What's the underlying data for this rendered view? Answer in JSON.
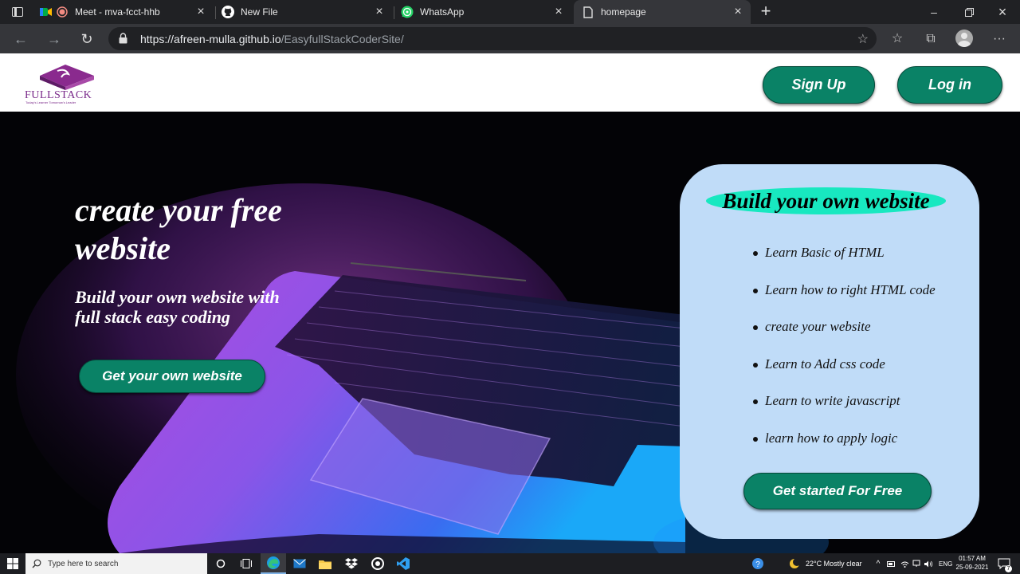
{
  "browser": {
    "tabs": [
      {
        "label": "Meet - mva-fcct-hhb"
      },
      {
        "label": "New File"
      },
      {
        "label": "WhatsApp"
      },
      {
        "label": "homepage"
      }
    ],
    "url_host": "https://afreen-mulla.github.io",
    "url_path": "/EasyfullStackCoderSite/"
  },
  "site": {
    "logo_text": "FULLSTACK",
    "logo_tagline": "Today's Learner Tomorrow's Leader",
    "signup_label": "Sign Up",
    "login_label": "Log in",
    "hero": {
      "title": "create your free website",
      "subtitle": "Build your own website with full stack easy coding",
      "cta_label": "Get your own website"
    },
    "card": {
      "title": "Build your own website",
      "items": [
        "Learn Basic of HTML",
        "Learn how to right HTML code",
        "create your website",
        "Learn to Add css code",
        "Learn to write javascript",
        "learn how to apply logic"
      ],
      "cta_label": "Get started For Free"
    }
  },
  "taskbar": {
    "search_placeholder": "Type here to search",
    "weather": "22°C  Mostly clear",
    "language": "ENG",
    "time": "01:57 AM",
    "date": "25-09-2021",
    "notifications": "7"
  },
  "colors": {
    "button_green": "#0a8266",
    "card_bg": "#c0dcf8",
    "card_title_bg": "#18e8c0",
    "logo_purple": "#7a2a8a"
  }
}
